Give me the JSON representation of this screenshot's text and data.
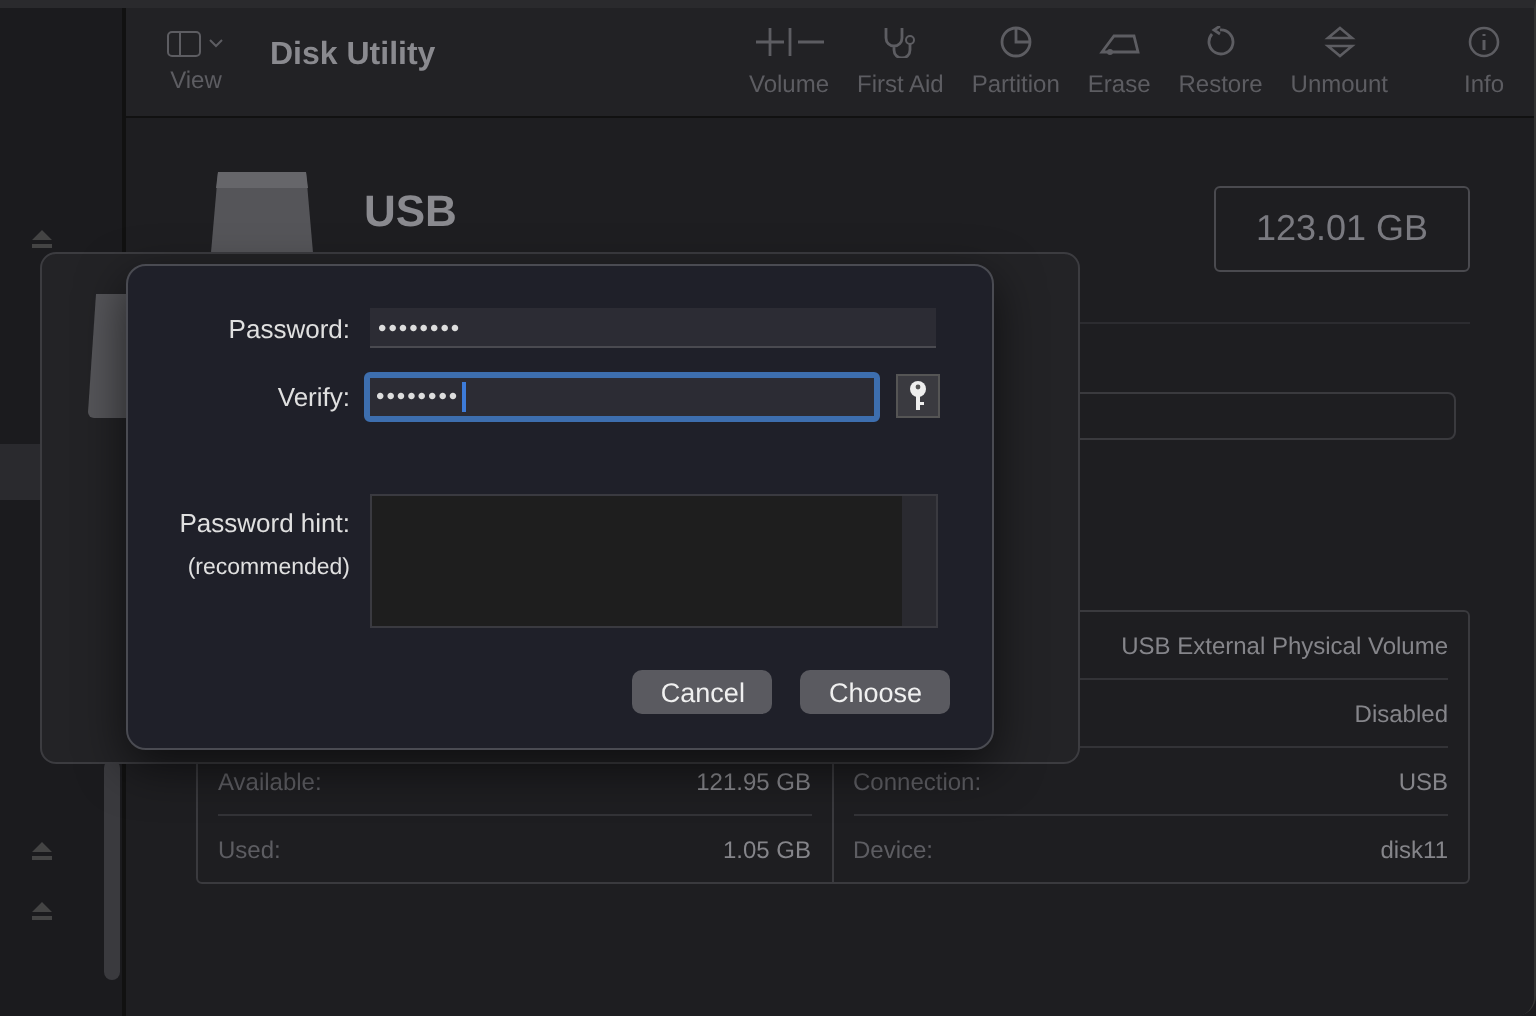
{
  "window": {
    "title": "Disk Utility",
    "view_label": "View"
  },
  "toolbar": [
    {
      "kind": "volume",
      "label": "Volume"
    },
    {
      "kind": "firstaid",
      "label": "First Aid"
    },
    {
      "kind": "partition",
      "label": "Partition"
    },
    {
      "kind": "erase",
      "label": "Erase"
    },
    {
      "kind": "restore",
      "label": "Restore"
    },
    {
      "kind": "unmount",
      "label": "Unmount"
    },
    {
      "kind": "info",
      "label": "Info"
    }
  ],
  "disk": {
    "name": "USB",
    "capacity": "123.01 GB"
  },
  "info": {
    "left": [
      {
        "label": "Available:",
        "value": "121.95 GB"
      },
      {
        "label": "Used:",
        "value": "1.05 GB"
      }
    ],
    "right": [
      {
        "value": "USB External Physical Volume"
      },
      {
        "value": "Disabled"
      },
      {
        "label": "Connection:",
        "value": "USB"
      },
      {
        "label": "Device:",
        "value": "disk11"
      }
    ]
  },
  "dialog": {
    "fields": [
      {
        "label": "Password:",
        "value": "••••••••",
        "focused": false
      },
      {
        "label": "Verify:",
        "value": "••••••••",
        "focused": true
      }
    ],
    "hint": {
      "label": "Password hint:",
      "note": "(recommended)"
    },
    "buttons": [
      {
        "label": "Cancel"
      },
      {
        "label": "Choose"
      }
    ]
  }
}
